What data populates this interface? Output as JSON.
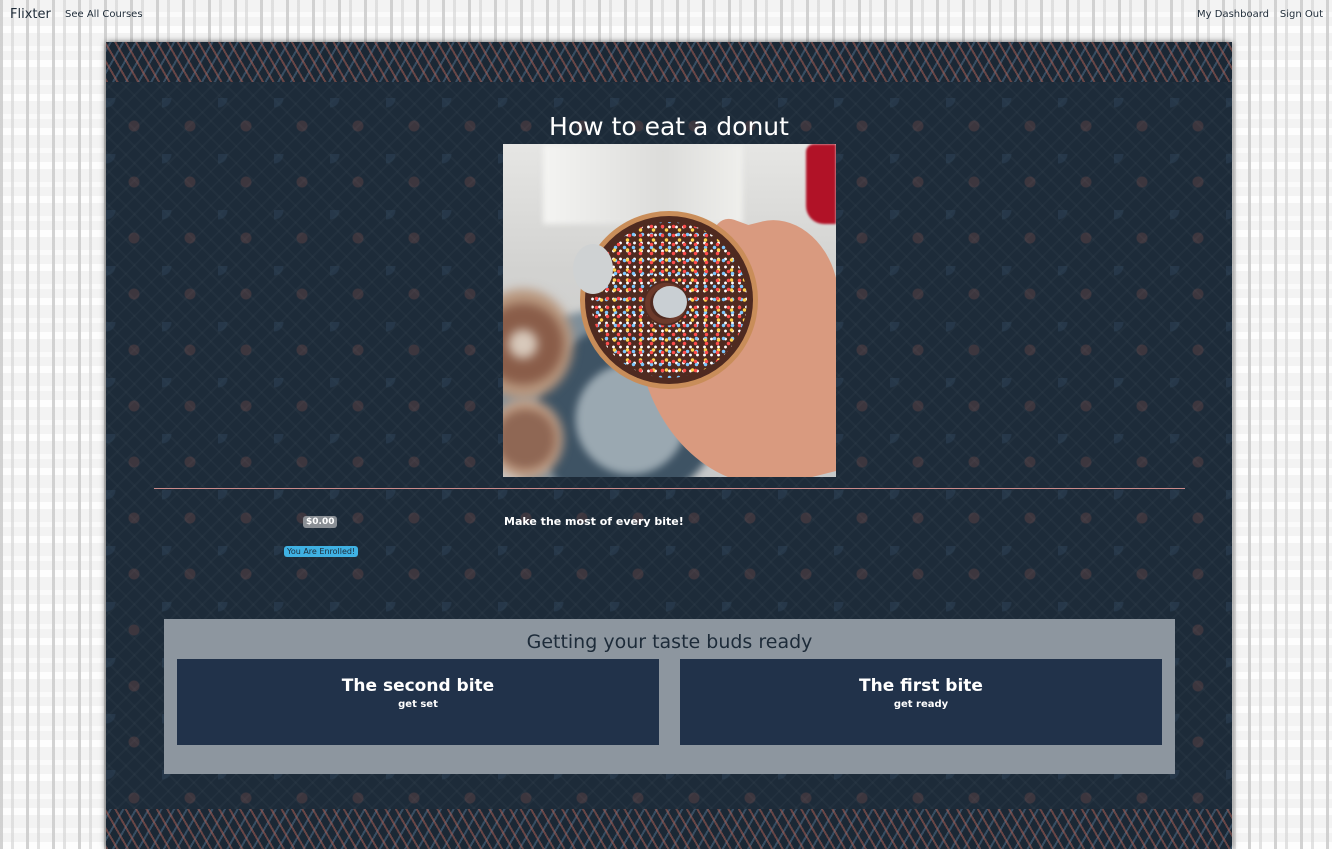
{
  "nav": {
    "brand": "Flixter",
    "see_all_courses": "See All Courses",
    "my_dashboard": "My Dashboard",
    "sign_out": "Sign Out"
  },
  "course": {
    "title": "How to eat a donut",
    "price": "$0.00",
    "enrollment_status": "You Are Enrolled!",
    "tagline": "Make the most of every bite!"
  },
  "chapter": {
    "title": "Getting your taste buds ready",
    "lessons": [
      {
        "title": "The second bite",
        "subtitle": "get set"
      },
      {
        "title": "The first bite",
        "subtitle": "get ready"
      }
    ]
  },
  "colors": {
    "card_background": "#1d2b39",
    "chapter_panel": "#8d969f",
    "lesson_tile": "#21324a",
    "enrolled_badge": "#3fb1e3",
    "price_badge": "#8a8f95",
    "divider": "#c98a8a"
  }
}
